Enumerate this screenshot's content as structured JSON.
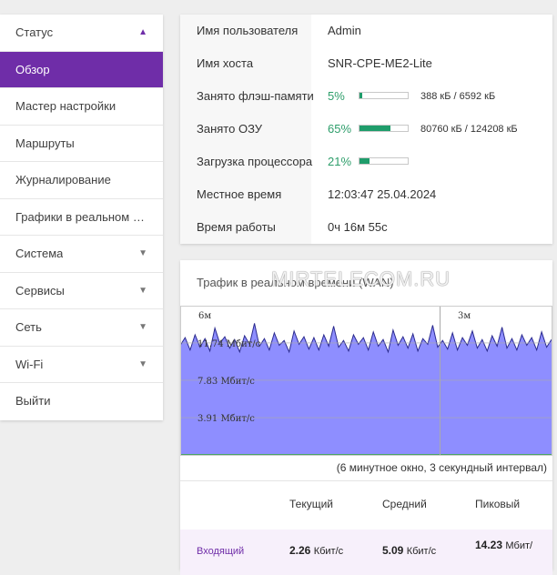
{
  "sidebar": {
    "items": [
      {
        "label": "Статус",
        "arrow": "▲"
      },
      {
        "label": "Обзор",
        "arrow": ""
      },
      {
        "label": "Мастер настройки",
        "arrow": ""
      },
      {
        "label": "Маршруты",
        "arrow": ""
      },
      {
        "label": "Журналирование",
        "arrow": ""
      },
      {
        "label": "Графики в реальном в...",
        "arrow": ""
      },
      {
        "label": "Система",
        "arrow": "▼"
      },
      {
        "label": "Сервисы",
        "arrow": "▼"
      },
      {
        "label": "Сеть",
        "arrow": "▼"
      },
      {
        "label": "Wi-Fi",
        "arrow": "▼"
      },
      {
        "label": "Выйти",
        "arrow": ""
      }
    ]
  },
  "status": {
    "rows": [
      {
        "key": "Имя пользователя",
        "value": "Admin"
      },
      {
        "key": "Имя хоста",
        "value": "SNR-CPE-ME2-Lite"
      },
      {
        "key": "Занято флэш-памяти",
        "pct": "5%",
        "fill": 0.05,
        "detail": "388 кБ / 6592 кБ"
      },
      {
        "key": "Занято ОЗУ",
        "pct": "65%",
        "fill": 0.65,
        "detail": "80760 кБ / 124208 кБ"
      },
      {
        "key": "Загрузка процессора",
        "pct": "21%",
        "fill": 0.21,
        "detail": ""
      },
      {
        "key": "Местное время",
        "value": "12:03:47 25.04.2024"
      },
      {
        "key": "Время работы",
        "value": "0ч 16м 55с"
      }
    ]
  },
  "traffic": {
    "title": "Трафик в реальном времени (WAN)",
    "watermark": "MIRTELECOM.RU",
    "interval": "(6 минутное окно, 3 секундный интервал)",
    "columns": {
      "current": "Текущий",
      "avg": "Средний",
      "peak": "Пиковый"
    },
    "row": {
      "label": "Входящий",
      "current": "2.26",
      "current_unit": "Кбит/с",
      "avg": "5.09",
      "avg_unit": "Кбит/с",
      "peak": "14.23",
      "peak_unit": "Мбит/"
    }
  },
  "chart_data": {
    "type": "area",
    "title": "",
    "time_labels": [
      "6м",
      "3м"
    ],
    "ytick_labels": [
      "11.74 Мбит/с",
      "7.83 Мбит/с",
      "3.91 Мбит/с"
    ],
    "series": [
      {
        "color": "#8888ff",
        "values": [
          11.5,
          12.3,
          11.0,
          12.6,
          11.3,
          12.2,
          10.9,
          13.3,
          11.7,
          12.4,
          11.2,
          12.1,
          10.8,
          12.5,
          11.6,
          13.8,
          11.4,
          12.2,
          11.0,
          12.8,
          11.5,
          12.0,
          10.8,
          13.0,
          11.6,
          12.4,
          11.1,
          12.3,
          11.0,
          12.6,
          11.4,
          13.5,
          11.3,
          12.0,
          10.9,
          12.6,
          11.6,
          12.3,
          11.0,
          12.9,
          11.4,
          12.1,
          10.8,
          13.1,
          11.5,
          12.4,
          11.2,
          12.7,
          10.9,
          12.2,
          11.6,
          13.6,
          11.3,
          12.0,
          11.1,
          12.8,
          11.0,
          12.3,
          11.5,
          13.0,
          11.2,
          12.1,
          10.9,
          12.5,
          11.4,
          13.4,
          11.2,
          12.2,
          11.0,
          12.6,
          11.5,
          12.3,
          11.0,
          12.9,
          11.3,
          12.1
        ]
      },
      {
        "color": "#33aa33",
        "values": [
          0.03,
          0.03,
          0.03,
          0.03,
          0.03,
          0.03,
          0.03,
          0.03,
          0.03,
          0.03,
          0.03,
          0.03,
          0.03,
          0.03,
          0.03,
          0.03,
          0.03,
          0.03,
          0.03,
          0.03,
          0.03,
          0.03,
          0.03,
          0.03,
          0.03,
          0.03,
          0.03,
          0.03,
          0.03,
          0.03,
          0.03,
          0.03,
          0.03,
          0.03,
          0.03,
          0.03,
          0.03,
          0.03,
          0.03,
          0.03,
          0.03,
          0.03,
          0.03,
          0.03,
          0.03,
          0.03,
          0.03,
          0.03,
          0.03,
          0.03,
          0.03,
          0.03,
          0.03,
          0.03,
          0.03,
          0.03,
          0.03,
          0.03,
          0.03,
          0.03,
          0.03,
          0.03,
          0.03,
          0.03,
          0.03,
          0.03,
          0.03,
          0.03,
          0.03,
          0.03,
          0.03,
          0.03,
          0.03,
          0.03,
          0.03
        ]
      }
    ],
    "ylim": [
      0,
      15.65
    ],
    "grid": true,
    "legend": "none"
  }
}
